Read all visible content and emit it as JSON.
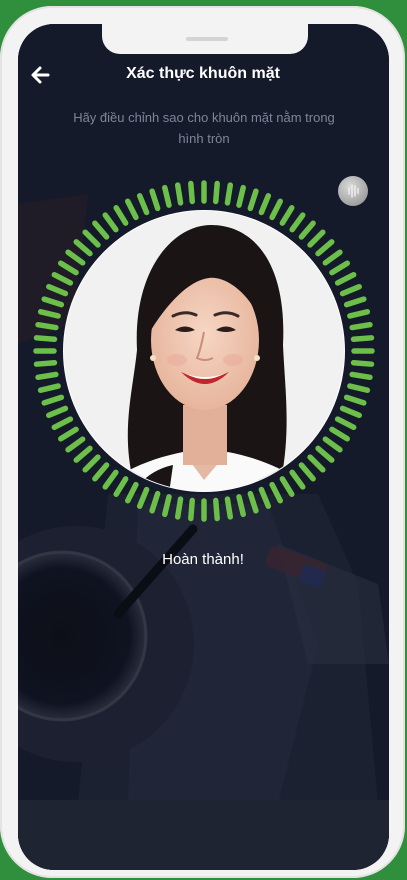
{
  "header": {
    "title": "Xác thực khuôn mặt",
    "back_icon": "arrow-left-icon"
  },
  "instruction": {
    "line1": "Hãy điều chỉnh sao cho khuôn mặt nằm trong",
    "line2": "hình tròn"
  },
  "sound_button": {
    "icon": "sound-wave-icon"
  },
  "scan": {
    "status": "Hoàn thành!",
    "progress": 1.0,
    "ring_color": "#6cc04a"
  },
  "colors": {
    "screen_background": "#151a2b",
    "phone_frame": "#f3f3f3",
    "page_background": "#2f8f3c"
  }
}
